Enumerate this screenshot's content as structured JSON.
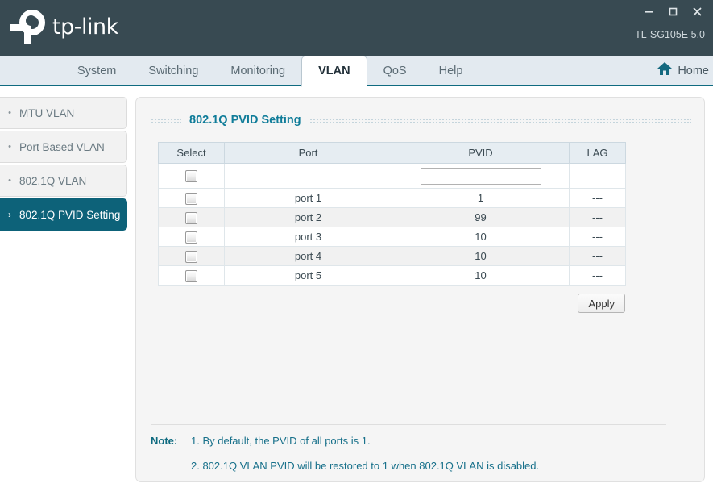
{
  "header": {
    "brand": "tp-link",
    "model": "TL-SG105E 5.0",
    "window_controls": [
      {
        "name": "minimize",
        "glyph": "–"
      },
      {
        "name": "maximize",
        "glyph": "❐"
      },
      {
        "name": "close",
        "glyph": "✕"
      }
    ]
  },
  "nav": {
    "tabs": [
      {
        "label": "System",
        "active": false
      },
      {
        "label": "Switching",
        "active": false
      },
      {
        "label": "Monitoring",
        "active": false
      },
      {
        "label": "VLAN",
        "active": true
      },
      {
        "label": "QoS",
        "active": false
      },
      {
        "label": "Help",
        "active": false
      }
    ],
    "home_label": "Home",
    "home_icon": "home-icon"
  },
  "sidebar": {
    "items": [
      {
        "label": "MTU VLAN",
        "marker": "•",
        "active": false
      },
      {
        "label": "Port Based VLAN",
        "marker": "•",
        "active": false
      },
      {
        "label": "802.1Q VLAN",
        "marker": "•",
        "active": false
      },
      {
        "label": "802.1Q PVID Setting",
        "marker": "›",
        "active": true
      }
    ]
  },
  "panel": {
    "title": "802.1Q PVID Setting",
    "table": {
      "columns": [
        "Select",
        "Port",
        "PVID",
        "LAG"
      ],
      "edit_row": {
        "pvid_value": "",
        "pvid_placeholder": ""
      },
      "rows": [
        {
          "port": "port 1",
          "pvid": "1",
          "lag": "---"
        },
        {
          "port": "port 2",
          "pvid": "99",
          "lag": "---"
        },
        {
          "port": "port 3",
          "pvid": "10",
          "lag": "---"
        },
        {
          "port": "port 4",
          "pvid": "10",
          "lag": "---"
        },
        {
          "port": "port 5",
          "pvid": "10",
          "lag": "---"
        }
      ]
    },
    "apply_label": "Apply",
    "note": {
      "label": "Note:",
      "line1": "1. By default, the PVID of all ports is 1.",
      "line2": "2. 802.1Q VLAN PVID will be restored to 1 when 802.1Q VLAN is disabled."
    }
  },
  "colors": {
    "header_bg": "#384a52",
    "nav_bg": "#e3eaf0",
    "accent_teal": "#0d6279",
    "title_teal": "#0f7c99",
    "note_teal": "#17708a",
    "panel_bg": "#f5f5f5"
  }
}
